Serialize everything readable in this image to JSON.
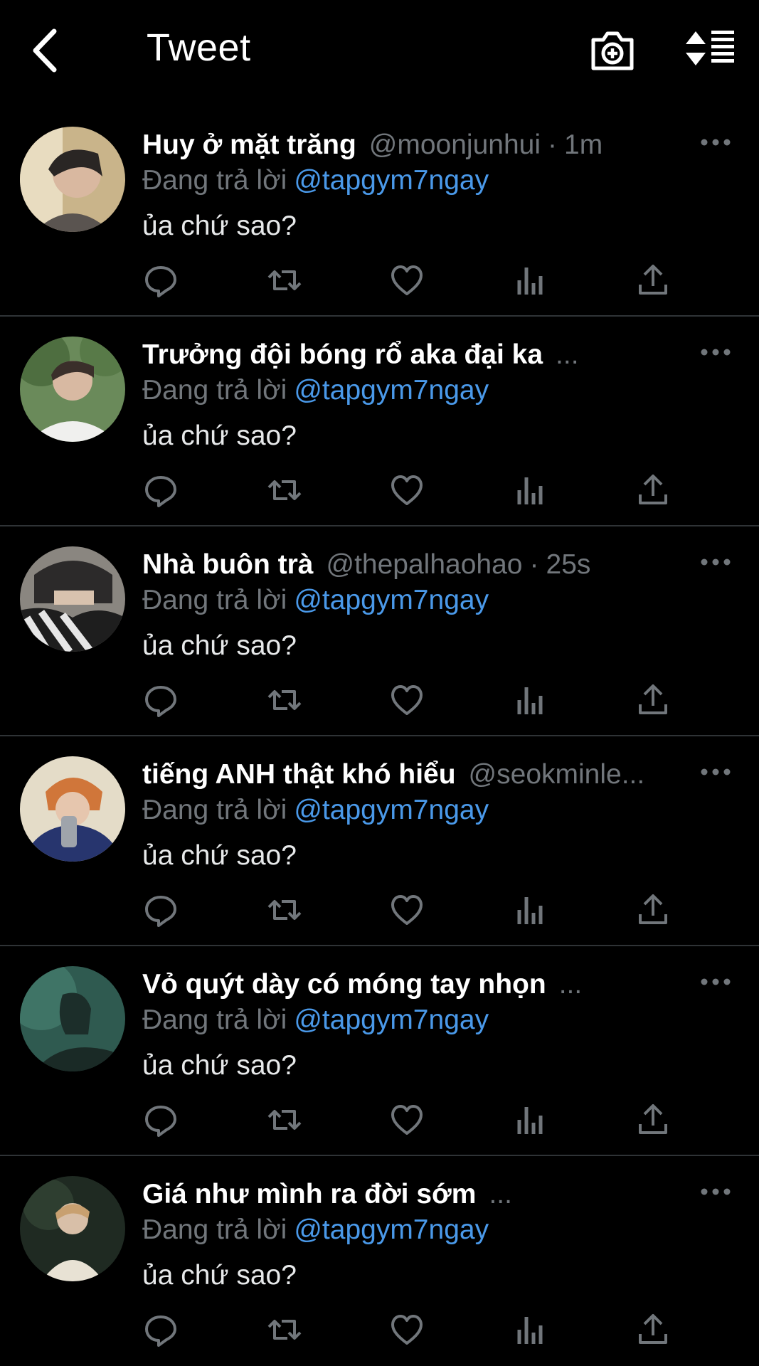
{
  "header": {
    "title": "Tweet",
    "back_icon": "chevron-left-icon",
    "camera_icon": "camera-plus-icon",
    "sort_icon": "sort-list-icon"
  },
  "replying_prefix": "Đang trả lời",
  "tweets": [
    {
      "name": "Huy ở mặt trăng",
      "handle": "@moonjunhui",
      "dot": "·",
      "time": "1m",
      "replying_to": "@tapgym7ngay",
      "text": "ủa chứ sao?"
    },
    {
      "name": "Trưởng đội bóng rổ aka đại ka",
      "handle": "...",
      "dot": "",
      "time": "",
      "replying_to": "@tapgym7ngay",
      "text": "ủa chứ sao?"
    },
    {
      "name": "Nhà buôn trà",
      "handle": "@thepalhaohao",
      "dot": "·",
      "time": "25s",
      "replying_to": "@tapgym7ngay",
      "text": "ủa chứ sao?"
    },
    {
      "name": "tiếng ANH thật khó hiểu",
      "handle": "@seokminle...",
      "dot": "",
      "time": "",
      "replying_to": "@tapgym7ngay",
      "text": "ủa chứ sao?"
    },
    {
      "name": "Vỏ quýt dày có móng tay nhọn",
      "handle": "...",
      "dot": "",
      "time": "",
      "replying_to": "@tapgym7ngay",
      "text": "ủa chứ sao?"
    },
    {
      "name": "Giá như mình ra đời sớm",
      "handle": "...",
      "dot": "",
      "time": "",
      "replying_to": "@tapgym7ngay",
      "text": "ủa chứ sao?"
    }
  ],
  "action_icons": [
    "reply-icon",
    "retweet-icon",
    "like-icon",
    "analytics-icon",
    "share-icon"
  ],
  "colors": {
    "background": "#000000",
    "muted": "#71767b",
    "mention": "#4a99e9",
    "divider": "#2f3336"
  }
}
